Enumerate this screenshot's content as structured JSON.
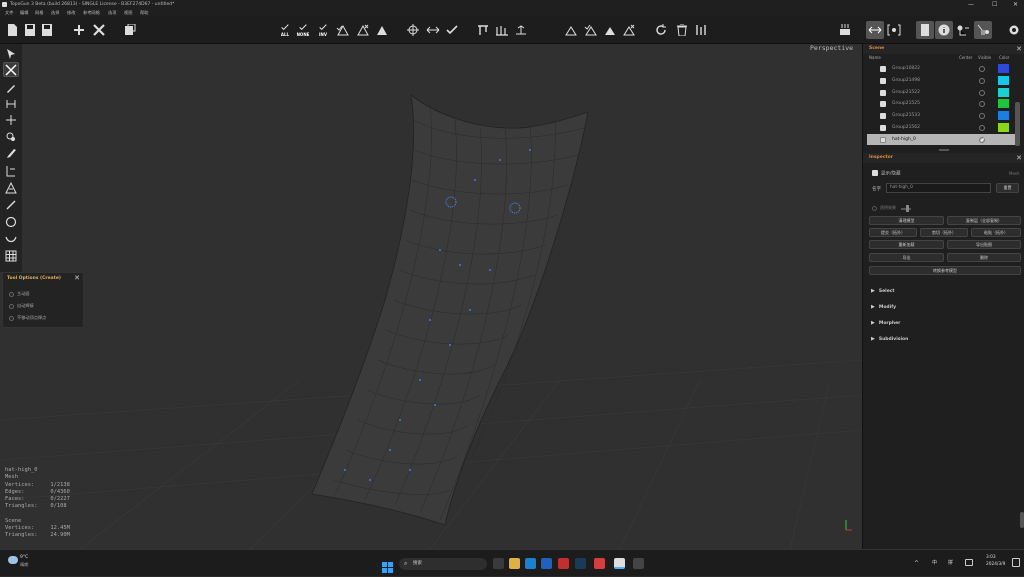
{
  "window": {
    "title": "TopoGun 3 Beta (build 26813) - SINGLE License - B3EF274D67 - untitled*",
    "controls": [
      "—",
      "☐",
      "✕"
    ]
  },
  "menu": [
    "文件",
    "编辑",
    "网格",
    "选择",
    "修改",
    "参考网格",
    "选项",
    "视图",
    "帮助"
  ],
  "toolbar": {
    "labels": {
      "all": "ALL",
      "none": "NONE",
      "inv": "INV"
    }
  },
  "viewport": {
    "label": "Perspective",
    "stats": {
      "object": "hat-high_0",
      "type": "Mesh",
      "vertices": "Vertices:     1/2138",
      "edges": "Edges:        0/4360",
      "faces": "Faces:        0/2227",
      "triangles": "Triangles:    0/108",
      "scene": "Scene",
      "scene_vertices": "Vertices:     12.45M",
      "scene_triangles": "Triangles:    24.90M"
    }
  },
  "tool_options": {
    "title": "Tool Options (Create)",
    "options": [
      "主动面",
      "自动焊接",
      "不移动顶点焊点"
    ]
  },
  "scene_panel": {
    "title": "Scene",
    "columns": {
      "name": "Name",
      "center": "Center",
      "visible": "Visible",
      "color": "Color"
    },
    "rows": [
      {
        "name": "Group10822",
        "color": "#2f4ad9"
      },
      {
        "name": "Group21498",
        "color": "#14c8e6"
      },
      {
        "name": "Group21522",
        "color": "#1ad0d0"
      },
      {
        "name": "Group21525",
        "color": "#22c33c"
      },
      {
        "name": "Group21533",
        "color": "#1a7fe0"
      },
      {
        "name": "Group21562",
        "color": "#8cd61a"
      },
      {
        "name": "hat-high_0",
        "color": ""
      }
    ]
  },
  "inspector": {
    "title": "Inspector",
    "show_hide": "显示/隐藏",
    "mesh_label": "Mesh",
    "name_label": "名字",
    "name_value": "hat-high_0",
    "reset": "重置",
    "opacity_label": "透明效果",
    "buttons": {
      "clean_model": "清理模型",
      "copy_all": "复制层（全部复制）",
      "extract_topo": "提交（拓扑）",
      "cut_topo": "剪切（拓扑）",
      "paste_topo": "粘贴（拓扑）",
      "reload": "重新加载",
      "import_map": "导出贴图",
      "export": "导出",
      "delete": "删除",
      "convert_ref": "转换参考模型"
    },
    "sections": [
      "Select",
      "Modify",
      "Morpher",
      "Subdivision"
    ]
  },
  "taskbar": {
    "weather_temp": "9°C",
    "weather_desc": "晴朗",
    "search": "搜索",
    "ime_lang": "中",
    "ime_mode": "拼",
    "time": "3:03",
    "date": "2024/3/9"
  }
}
